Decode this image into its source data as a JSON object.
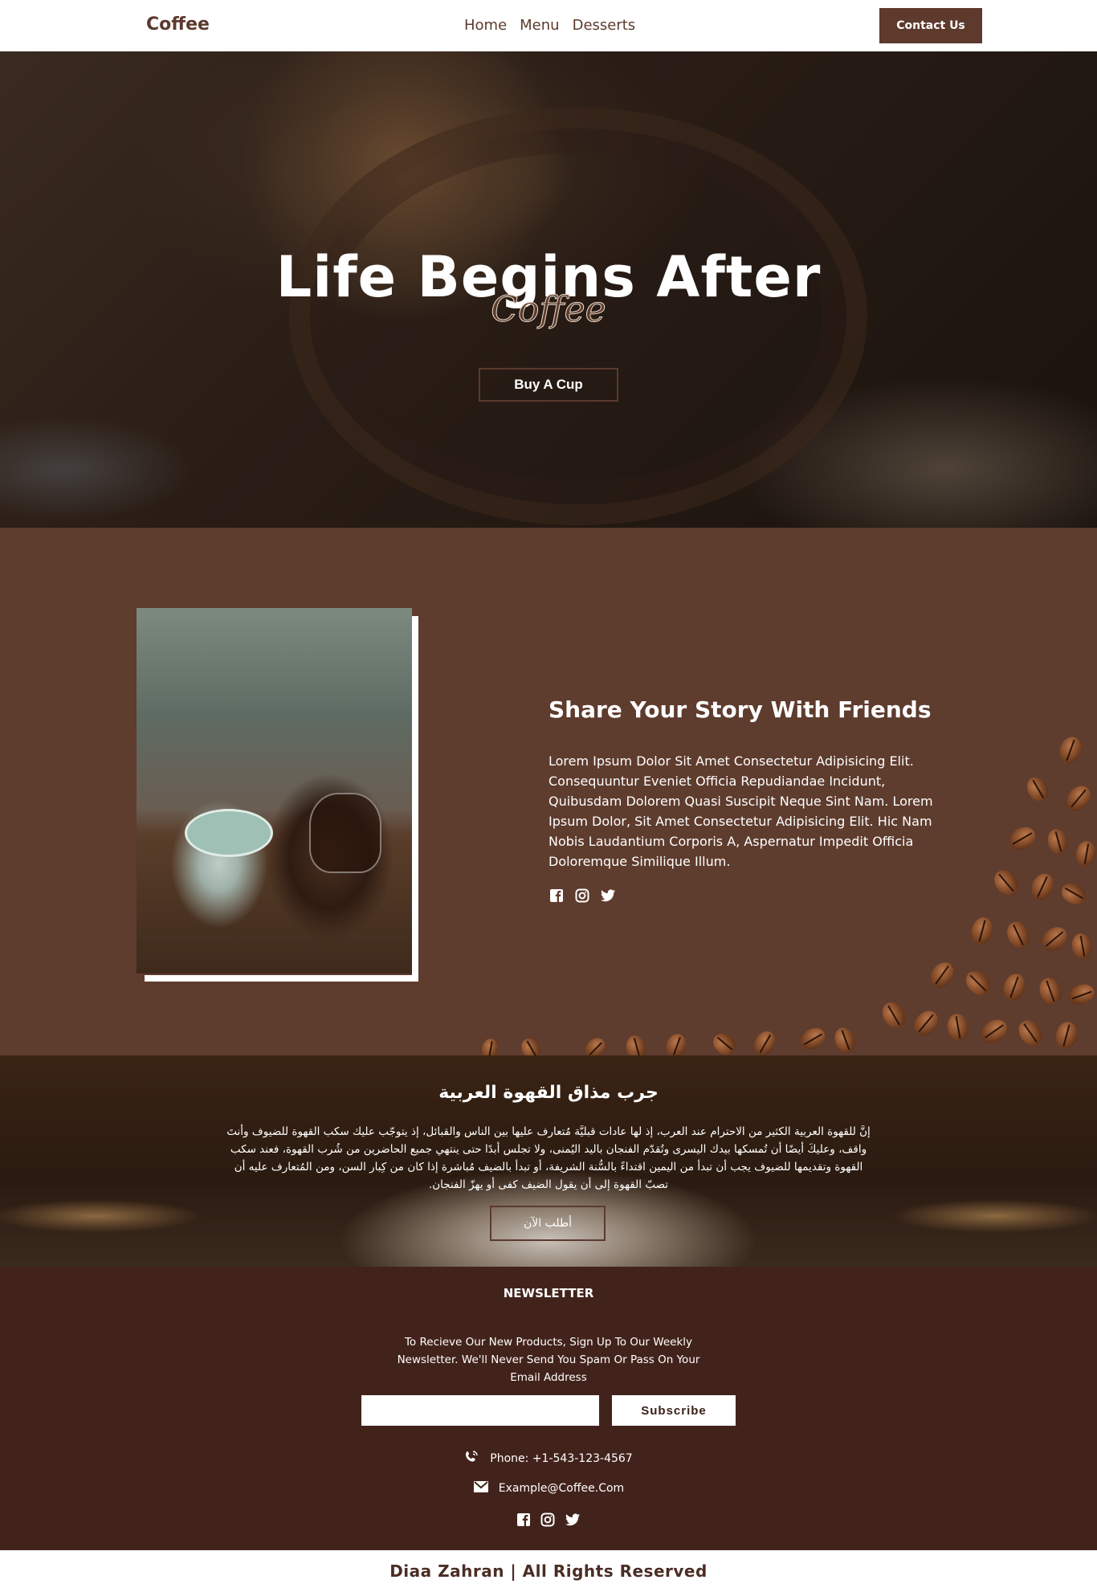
{
  "nav": {
    "brand": "Coffee",
    "links": [
      "Home",
      "Menu",
      "Desserts"
    ],
    "contact_label": "Contact Us"
  },
  "hero": {
    "title": "Life Begins After",
    "script": "Coffee",
    "button_label": "Buy A Cup"
  },
  "story": {
    "heading": "Share Your Story With Friends",
    "body": "Lorem Ipsum Dolor Sit Amet Consectetur Adipisicing Elit. Consequuntur Eveniet Officia Repudiandae Incidunt, Quibusdam Dolorem Quasi Suscipit Neque Sint Nam. Lorem Ipsum Dolor, Sit Amet Consectetur Adipisicing Elit. Hic Nam Nobis Laudantium Corporis A, Aspernatur Impedit Officia Doloremque Similique Illum.",
    "social": [
      "facebook-icon",
      "instagram-icon",
      "twitter-icon"
    ]
  },
  "arabic": {
    "heading": "جرب مذاق القهوة العربية",
    "body": "إنَّ للقهوة العربية الكثير من الاحترام عند العرب، إذ لها عادات قبليَّة مُتعارف عليها بين الناس والقبائل، إذ يتوجّب عليك سكب القهوة للضيوف وأنتَ واقف، وعليكَ أيضًا أن تُمسكها بيدك اليسرى وتُقدّم الفنجان باليد اليُمنى، ولا تجلس أبدًا حتى ينتهي جميع الحاضرين من شُرب القهوة، فعند سكب القهوة وتقديمها للضيوف يجب أن تبدأ من اليمين اقتداءً بالسُّنة الشريفة، أو تبدأ بالضيف مُباشرة إذا كان من كِبار السن، ومن المُتعارف عليه أن تصبّ القهوة إلى أن يقول الضيف كفى أو يهزّ الفنجان.",
    "button_label": "أطلب الآن"
  },
  "newsletter": {
    "heading": "NEWSLETTER",
    "description": "To Recieve Our New Products, Sign Up To Our Weekly Newsletter. We'll Never Send You Spam Or Pass On Your Email Address",
    "email_value": "",
    "subscribe_label": "Subscribe",
    "phone": "Phone: +1-543-123-4567",
    "email": "Example@Coffee.Com"
  },
  "footer": {
    "text": "Diaa Zahran | All Rights Reserved"
  },
  "colors": {
    "brand_brown": "#5e3a2d",
    "section_brown": "#5e3c2e",
    "dark_brown": "#42231b"
  }
}
